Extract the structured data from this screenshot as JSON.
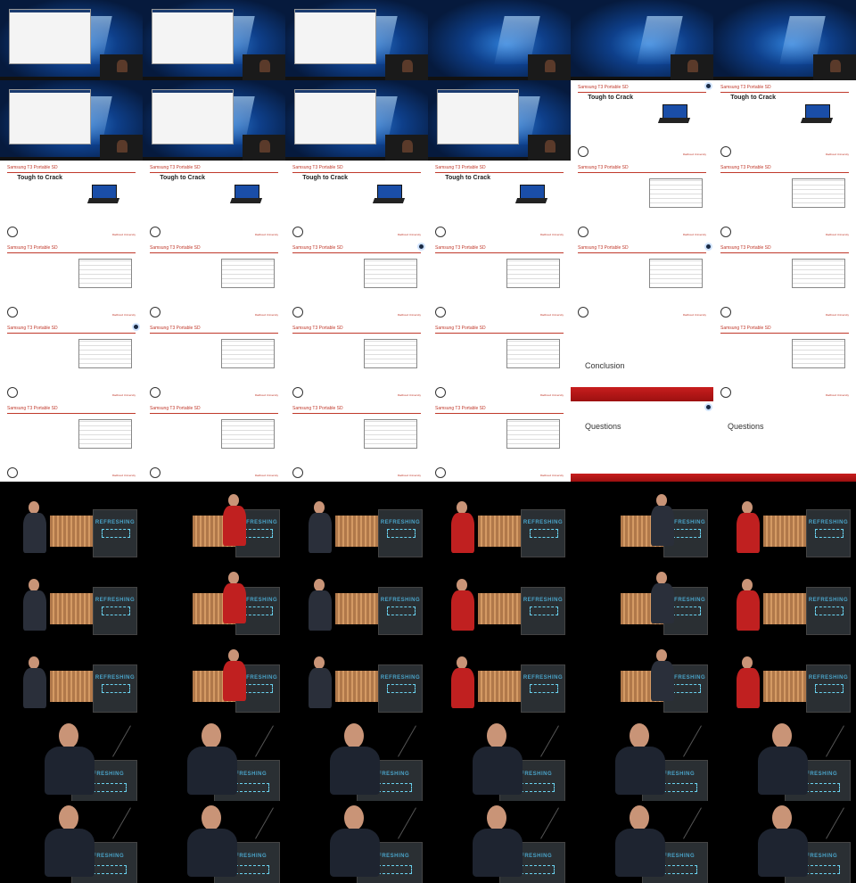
{
  "contact_sheet": {
    "columns": 6,
    "rows": 11,
    "cell_text": {
      "slide_header": "Samsung T3 Portable SD",
      "tough": "Tough to Crack",
      "conclusion": "Conclusion",
      "questions": "Questions",
      "footer": "Radboud University",
      "stage_banner": "REFRESHING"
    },
    "rows_content": [
      {
        "kind": "desktop"
      },
      {
        "kind": "desktop-windows"
      },
      {
        "kind": "slide-tough"
      },
      {
        "kind": "slide-mixed"
      },
      {
        "kind": "slide-conclusion"
      },
      {
        "kind": "slide-questions"
      },
      {
        "kind": "stage"
      },
      {
        "kind": "stage"
      },
      {
        "kind": "stage"
      },
      {
        "kind": "stage-closeup"
      },
      {
        "kind": "stage-closeup"
      }
    ]
  }
}
